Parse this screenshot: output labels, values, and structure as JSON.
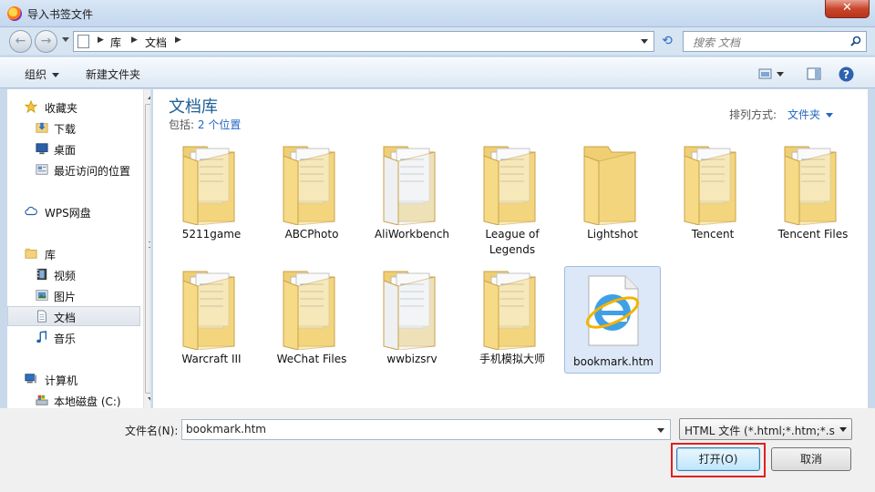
{
  "window": {
    "title": "导入书签文件",
    "close_symbol": "✕"
  },
  "nav": {
    "back_symbol": "←",
    "forward_symbol": "→",
    "breadcrumb": [
      "库",
      "文档"
    ],
    "refresh_symbol": "⟲",
    "search_placeholder": "搜索 文档"
  },
  "toolbar": {
    "organize_label": "组织",
    "new_folder_label": "新建文件夹",
    "help_symbol": "?"
  },
  "sidebar": {
    "items": [
      {
        "label": "收藏夹",
        "icon": "star-icon"
      },
      {
        "label": "下载",
        "icon": "download-folder-icon"
      },
      {
        "label": "桌面",
        "icon": "desktop-icon"
      },
      {
        "label": "最近访问的位置",
        "icon": "recent-places-icon"
      },
      {
        "label": "WPS网盘",
        "icon": "cloud-icon"
      },
      {
        "label": "库",
        "icon": "library-icon"
      },
      {
        "label": "视频",
        "icon": "video-icon"
      },
      {
        "label": "图片",
        "icon": "pictures-icon"
      },
      {
        "label": "文档",
        "icon": "documents-icon"
      },
      {
        "label": "音乐",
        "icon": "music-icon"
      },
      {
        "label": "计算机",
        "icon": "computer-icon"
      },
      {
        "label": "本地磁盘 (C:)",
        "icon": "disk-icon"
      }
    ],
    "selected": "文档"
  },
  "content": {
    "library_title": "文档库",
    "includes_label": "包括:",
    "includes_link": "2 个位置",
    "sort_label": "排列方式:",
    "sort_value": "文件夹",
    "items": [
      {
        "name": "5211game",
        "type": "folder"
      },
      {
        "name": "ABCPhoto",
        "type": "folder"
      },
      {
        "name": "AliWorkbench",
        "type": "folder-white"
      },
      {
        "name": "League of Legends",
        "type": "folder"
      },
      {
        "name": "Lightshot",
        "type": "folder-empty"
      },
      {
        "name": "Tencent",
        "type": "folder"
      },
      {
        "name": "Tencent Files",
        "type": "folder"
      },
      {
        "name": "Warcraft III",
        "type": "folder"
      },
      {
        "name": "WeChat Files",
        "type": "folder"
      },
      {
        "name": "wwbizsrv",
        "type": "folder-white"
      },
      {
        "name": "手机模拟大师",
        "type": "folder"
      },
      {
        "name": "bookmark.htm",
        "type": "htm-file",
        "selected": true
      }
    ]
  },
  "footer": {
    "filename_label": "文件名(N):",
    "filename_value": "bookmark.htm",
    "filter_value": "HTML 文件 (*.html;*.htm;*.sht",
    "open_label": "打开(O)",
    "cancel_label": "取消"
  },
  "colors": {
    "accent_link": "#2165c4",
    "library_title": "#1e5f96",
    "annotation_box": "#e02020"
  }
}
